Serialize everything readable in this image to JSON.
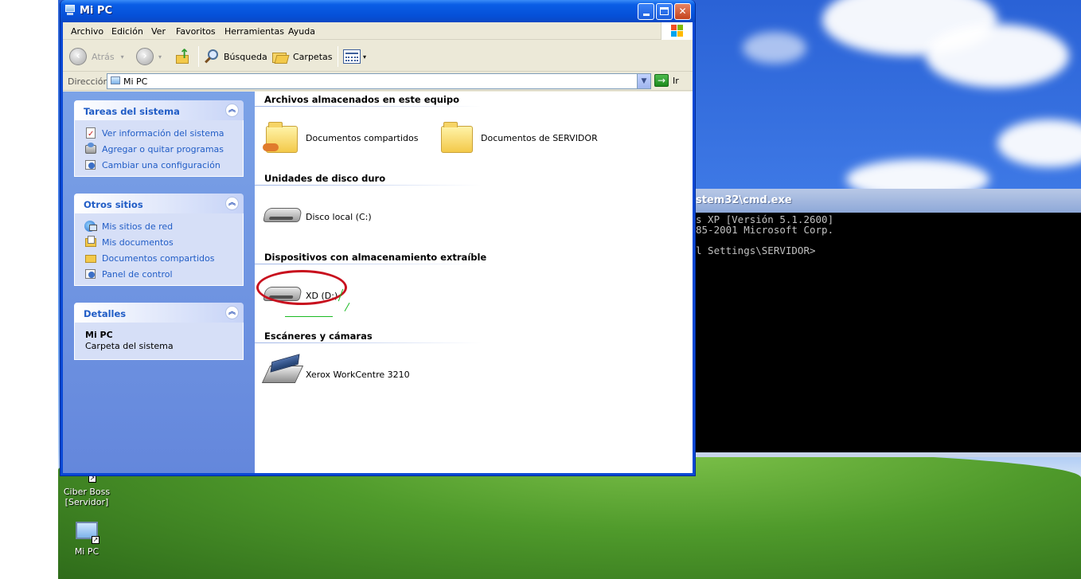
{
  "window": {
    "title": "Mi PC",
    "controls": {
      "minimize": "_",
      "maximize": "□",
      "close": "✕"
    }
  },
  "menubar": [
    "Archivo",
    "Edición",
    "Ver",
    "Favoritos",
    "Herramientas",
    "Ayuda"
  ],
  "toolbar": {
    "back": "Atrás",
    "search": "Búsqueda",
    "folders": "Carpetas"
  },
  "address": {
    "label": "Dirección",
    "value": "Mi PC",
    "go": "Ir"
  },
  "sidebar": {
    "system_tasks": {
      "title": "Tareas del sistema",
      "items": [
        "Ver información del sistema",
        "Agregar o quitar programas",
        "Cambiar una configuración"
      ]
    },
    "other_places": {
      "title": "Otros sitios",
      "items": [
        "Mis sitios de red",
        "Mis documentos",
        "Documentos compartidos",
        "Panel de control"
      ]
    },
    "details": {
      "title": "Detalles",
      "name": "Mi PC",
      "type": "Carpeta del sistema"
    }
  },
  "groups": [
    {
      "title": "Archivos almacenados en este equipo",
      "items": [
        "Documentos compartidos",
        "Documentos de SERVIDOR"
      ]
    },
    {
      "title": "Unidades de disco duro",
      "items": [
        "Disco local (C:)"
      ]
    },
    {
      "title": "Dispositivos con almacenamiento extraíble",
      "items": [
        "XD (D:)"
      ]
    },
    {
      "title": "Escáneres y cámaras",
      "items": [
        "Xerox WorkCentre 3210"
      ]
    }
  ],
  "cmd": {
    "title": "stem32\\cmd.exe",
    "lines": [
      "s XP [Versión 5.1.2600]",
      "85-2001 Microsoft Corp.",
      "",
      "l Settings\\SERVIDOR>"
    ]
  },
  "desktop_icons": [
    {
      "label_line1": "Ciber Boss",
      "label_line2": "[Servidor]"
    },
    {
      "label_line1": "Mi PC"
    }
  ],
  "colors": {
    "accent": "#0a5ee6",
    "link": "#215dc6",
    "highlight": "#c8101e"
  }
}
